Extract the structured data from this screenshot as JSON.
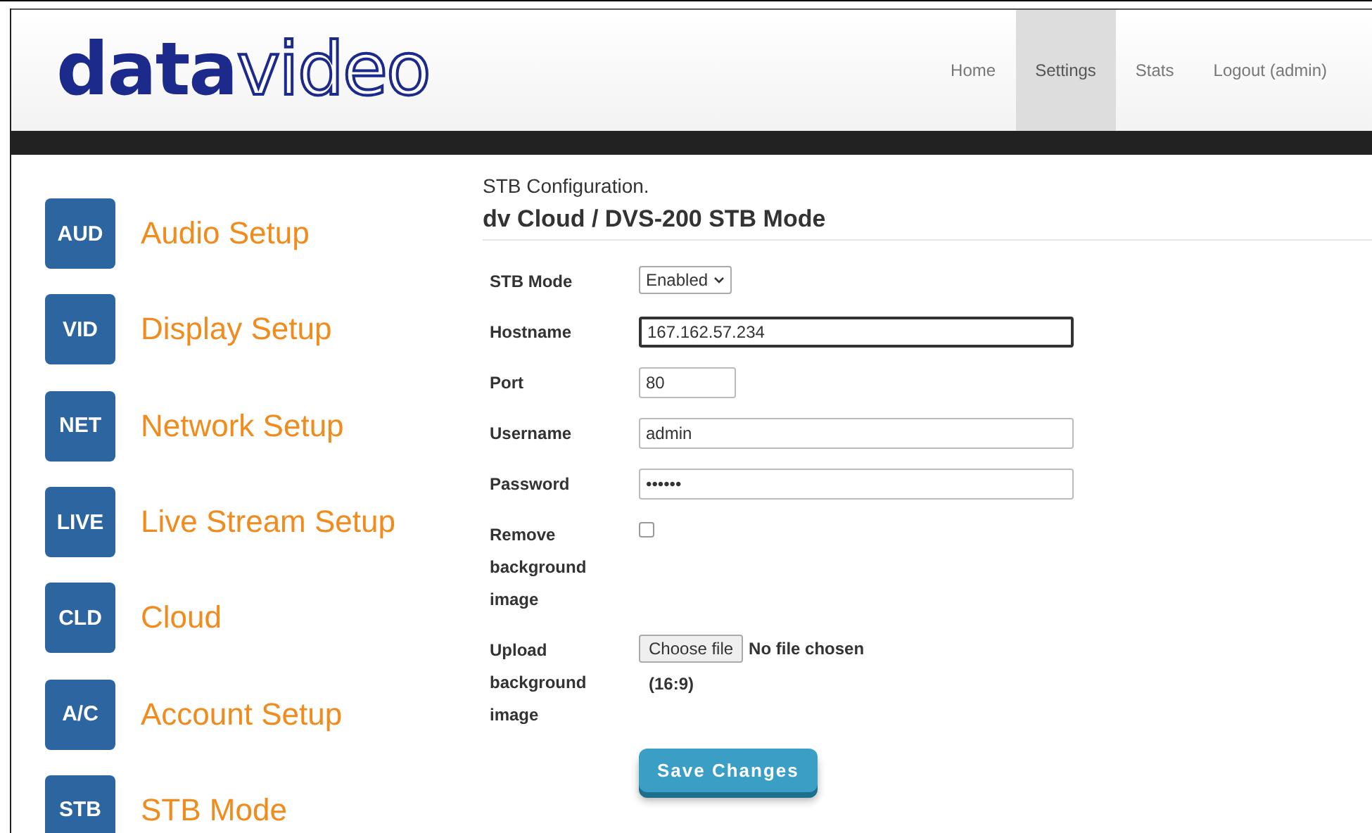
{
  "logo": {
    "bold": "data",
    "outline": "video"
  },
  "nav": [
    {
      "label": "Home",
      "selected": false
    },
    {
      "label": "Settings",
      "selected": true
    },
    {
      "label": "Stats",
      "selected": false
    },
    {
      "label": "Logout (admin)",
      "selected": false
    }
  ],
  "sidebar": {
    "items": [
      {
        "badge": "AUD",
        "label": "Audio Setup"
      },
      {
        "badge": "VID",
        "label": "Display Setup"
      },
      {
        "badge": "NET",
        "label": "Network Setup"
      },
      {
        "badge": "LIVE",
        "label": "Live Stream Setup"
      },
      {
        "badge": "CLD",
        "label": "Cloud"
      },
      {
        "badge": "A/C",
        "label": "Account Setup"
      },
      {
        "badge": "STB",
        "label": "STB Mode"
      }
    ]
  },
  "content": {
    "caption": "STB Configuration.",
    "heading": "dv Cloud / DVS-200 STB Mode",
    "fields": [
      {
        "kind": "select",
        "label": "STB Mode",
        "value": "Enabled"
      },
      {
        "kind": "text",
        "label": "Hostname",
        "value": "167.162.57.234",
        "focused": true
      },
      {
        "kind": "number",
        "label": "Port",
        "value": "80",
        "focused": false
      },
      {
        "kind": "text",
        "label": "Username",
        "value": "admin",
        "focused": false
      },
      {
        "kind": "password",
        "label": "Password",
        "value": "••••••",
        "focused": false
      },
      {
        "kind": "checkbox",
        "label": "Remove background image",
        "checked": false
      },
      {
        "kind": "file",
        "label": "Upload background image",
        "button": "Choose file",
        "status": "No file chosen",
        "hint": "(16:9)"
      }
    ],
    "save_button": "Save Changes"
  }
}
